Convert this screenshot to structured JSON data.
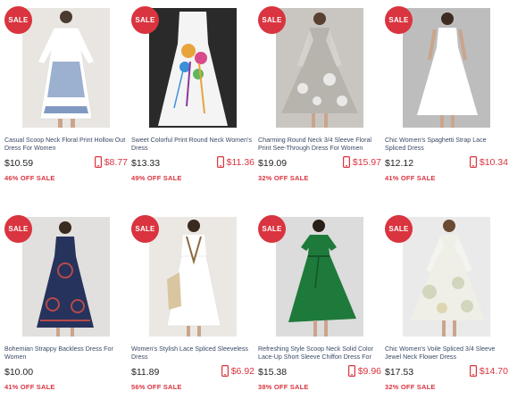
{
  "products": [
    {
      "sale_badge": "SALE",
      "title": "Casual Scoop Neck Floral Print Hollow Out Dress For Women",
      "price": "$10.59",
      "mobile_price": "$8.77",
      "discount": "46% OFF SALE",
      "dress_color": "#ffffff",
      "accent": "#4a6fa8",
      "bg": "#e9e6e2"
    },
    {
      "sale_badge": "SALE",
      "title": "Sweet Colorful Print Round Neck Women's Dress",
      "price": "$13.33",
      "mobile_price": "$11.36",
      "discount": "49% OFF SALE",
      "dress_color": "#f4f4f4",
      "accent": "#e8a43a",
      "bg": "#ececec"
    },
    {
      "sale_badge": "SALE",
      "title": "Charming Round Neck 3/4 Sleeve Floral Print See-Through Dress For Women",
      "price": "$19.09",
      "mobile_price": "$15.97",
      "discount": "32% OFF SALE",
      "dress_color": "#b7b4ae",
      "accent": "#ffffff",
      "bg": "#c9c6c2"
    },
    {
      "sale_badge": "SALE",
      "title": "Chic Women's Spaghetti Strap Lace Spliced Dress",
      "price": "$12.12",
      "mobile_price": "$10.34",
      "discount": "41% OFF SALE",
      "dress_color": "#ffffff",
      "accent": "#e6e6e6",
      "bg": "#bdbdbd"
    },
    {
      "sale_badge": "SALE",
      "title": "Bohemian Strappy Backless Dress For Women",
      "price": "$10.00",
      "mobile_price": "",
      "discount": "41% OFF SALE",
      "dress_color": "#26335c",
      "accent": "#b64a4a",
      "bg": "#e2e0de"
    },
    {
      "sale_badge": "SALE",
      "title": "Women's Stylish Lace Spliced Sleeveless Dress",
      "price": "$11.89",
      "mobile_price": "$6.92",
      "discount": "56% OFF SALE",
      "dress_color": "#ffffff",
      "accent": "#d9c6a0",
      "bg": "#ebe8e4"
    },
    {
      "sale_badge": "SALE",
      "title": "Refreshing Style Scoop Neck Solid Color Lace-Up Short Sleeve Chiffon Dress For",
      "price": "$15.38",
      "mobile_price": "$9.96",
      "discount": "38% OFF SALE",
      "dress_color": "#1e7a3a",
      "accent": "#145428",
      "bg": "#dcdcdc"
    },
    {
      "sale_badge": "SALE",
      "title": "Chic Women's Voile Spliced 3/4 Sleeve Jewel Neck Flower Dress",
      "price": "$17.53",
      "mobile_price": "$14.70",
      "discount": "32% OFF SALE",
      "dress_color": "#efefe8",
      "accent": "#c9cfb0",
      "bg": "#eaeaea"
    }
  ]
}
